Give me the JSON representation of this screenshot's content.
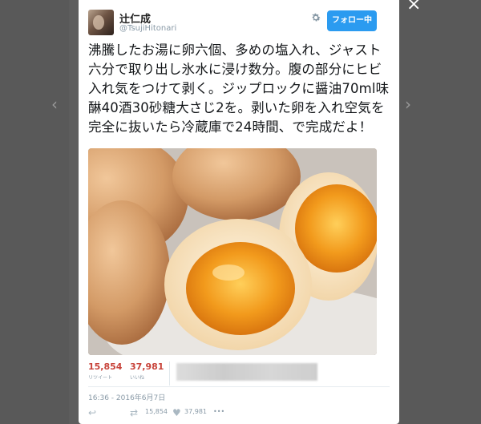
{
  "viewer": {
    "prev_icon": "‹",
    "next_icon": "›",
    "close_icon": "×"
  },
  "tweet": {
    "display_name": "辻仁成",
    "handle": "@TsujiHitonari",
    "follow_label": "フォロー中",
    "text": "沸騰したお湯に卵六個、多めの塩入れ、ジャスト六分で取り出し氷水に浸け数分。腹の部分にヒビ入れ気をつけて剥く。ジップロックに醤油70ml味醂40酒30砂糖大さじ2を。剥いた卵を入れ空気を完全に抜いたら冷蔵庫で24時間、で完成だよ！",
    "retweets": "15,854",
    "retweets_label": "リツイート",
    "likes": "37,981",
    "likes_label": "いいね",
    "timestamp": "16:36 - 2016年6月7日",
    "action_retweet_count": "15,854",
    "action_like_count": "37,981",
    "more_label": "•••"
  },
  "icons": {
    "avatar": "avatar-image",
    "gear": "gear-icon",
    "reply": "reply-icon",
    "retweet": "retweet-icon",
    "like": "heart-icon",
    "more": "more-icon"
  },
  "colors": {
    "follow_button": "#2b9bf0",
    "stat_numbers": "#c8443b",
    "overlay": "#5d5d5d"
  }
}
